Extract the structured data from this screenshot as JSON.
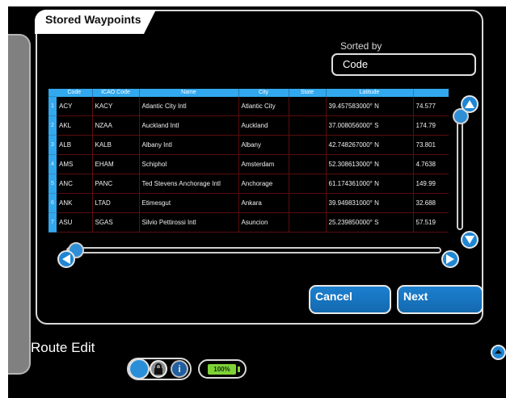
{
  "panel": {
    "title": "Stored Waypoints"
  },
  "sort": {
    "label": "Sorted by",
    "value": "Code"
  },
  "table": {
    "columns": [
      "Code",
      "ICAO Code",
      "Name",
      "City",
      "State",
      "Latitude",
      ""
    ],
    "rows": [
      {
        "index": "1",
        "code": "ACY",
        "icao": "KACY",
        "name": "Atlantic City Intl",
        "city": "Atlantic City",
        "state": "",
        "latitude": "39.457583000° N",
        "longitude": "74.577"
      },
      {
        "index": "2",
        "code": "AKL",
        "icao": "NZAA",
        "name": "Auckland Intl",
        "city": "Auckland",
        "state": "",
        "latitude": "37.008056000° S",
        "longitude": "174.79"
      },
      {
        "index": "3",
        "code": "ALB",
        "icao": "KALB",
        "name": "Albany Intl",
        "city": "Albany",
        "state": "",
        "latitude": "42.748267000° N",
        "longitude": "73.801"
      },
      {
        "index": "4",
        "code": "AMS",
        "icao": "EHAM",
        "name": "Schiphol",
        "city": "Amsterdam",
        "state": "",
        "latitude": "52.308613000° N",
        "longitude": "4.7638"
      },
      {
        "index": "5",
        "code": "ANC",
        "icao": "PANC",
        "name": "Ted Stevens Anchorage Intl",
        "city": "Anchorage",
        "state": "",
        "latitude": "61.174361000° N",
        "longitude": "149.99"
      },
      {
        "index": "6",
        "code": "ANK",
        "icao": "LTAD",
        "name": "Etimesgut",
        "city": "Ankara",
        "state": "",
        "latitude": "39.949831000° N",
        "longitude": "32.688"
      },
      {
        "index": "7",
        "code": "ASU",
        "icao": "SGAS",
        "name": "Silvio Pettirossi Intl",
        "city": "Asuncion",
        "state": "",
        "latitude": "25.239850000° S",
        "longitude": "57.519"
      }
    ]
  },
  "buttons": {
    "cancel": "Cancel",
    "next": "Next"
  },
  "footer": {
    "route_label": "Route Edit",
    "battery": "100%",
    "info_glyph": "i"
  },
  "icons": {
    "scroll_up": "up-arrow-icon",
    "scroll_down": "down-arrow-icon",
    "scroll_left": "left-arrow-icon",
    "scroll_right": "right-arrow-icon",
    "lock": "lock-icon",
    "info": "info-icon",
    "battery": "battery-icon",
    "collapse": "collapse-up-icon"
  },
  "colors": {
    "accent": "#32a8ee",
    "button": "#1c80cf",
    "grid": "#5a0c0c",
    "battery": "#7fd236"
  }
}
